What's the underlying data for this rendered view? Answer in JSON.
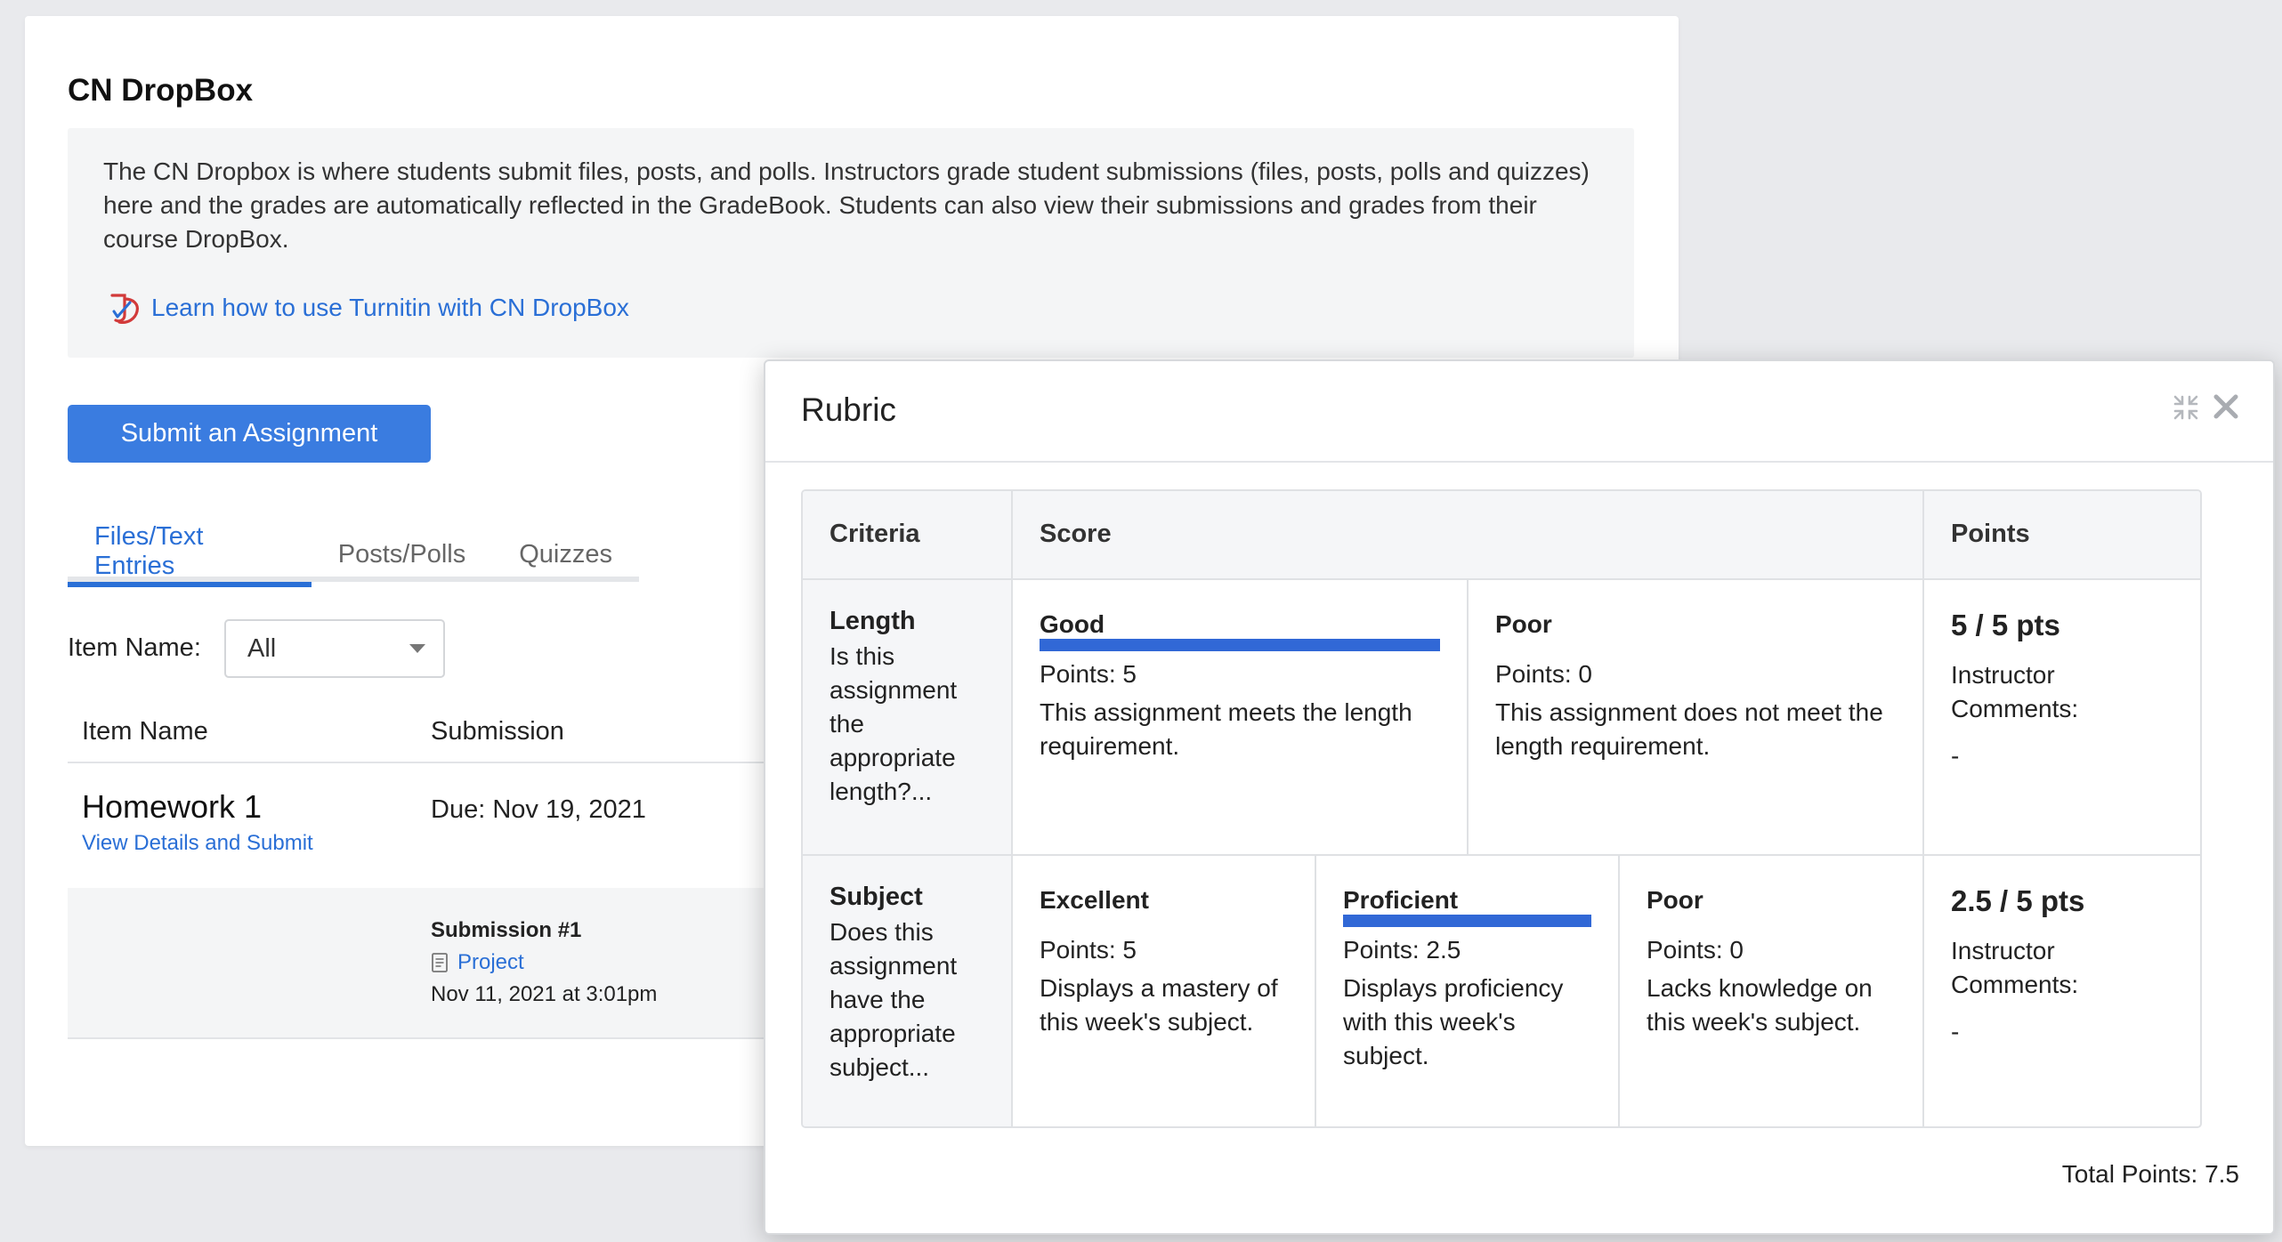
{
  "page": {
    "title": "CN DropBox",
    "info_text": "The CN Dropbox is where students submit files, posts, and polls. Instructors grade student submissions (files, posts, polls and quizzes) here and the grades are automatically reflected in the GradeBook. Students can also view their submissions and grades from their course DropBox.",
    "turnitin_link": "Learn how to use Turnitin with CN DropBox",
    "submit_button": "Submit an Assignment",
    "tabs": [
      {
        "label": "Files/Text Entries",
        "active": true
      },
      {
        "label": "Posts/Polls",
        "active": false
      },
      {
        "label": "Quizzes",
        "active": false
      }
    ],
    "filter": {
      "label": "Item Name:",
      "selected": "All"
    },
    "table": {
      "headers": [
        "Item Name",
        "Submission"
      ],
      "item": {
        "title": "Homework 1",
        "link": "View Details and Submit",
        "due": "Due: Nov 19, 2021",
        "submission": {
          "title": "Submission #1",
          "file": "Project",
          "date": "Nov 11, 2021 at 3:01pm"
        }
      }
    }
  },
  "rubric": {
    "title": "Rubric",
    "headers": {
      "criteria": "Criteria",
      "score": "Score",
      "points": "Points"
    },
    "criteria": [
      {
        "name": "Length",
        "description": "Is this assignment the appropriate length?...",
        "ratings": [
          {
            "label": "Good",
            "points": "Points: 5",
            "description": "This assignment meets the length requirement.",
            "selected": true
          },
          {
            "label": "Poor",
            "points": "Points: 0",
            "description": "This assignment does not meet the length requirement.",
            "selected": false
          }
        ],
        "score": "5 / 5 pts",
        "comments_label": "Instructor Comments:",
        "comments": "-"
      },
      {
        "name": "Subject",
        "description": "Does this assignment have the appropriate subject...",
        "ratings": [
          {
            "label": "Excellent",
            "points": "Points: 5",
            "description": "Displays a mastery of this week's subject.",
            "selected": false
          },
          {
            "label": "Proficient",
            "points": "Points: 2.5",
            "description": "Displays proficiency with this week's subject.",
            "selected": true
          },
          {
            "label": "Poor",
            "points": "Points: 0",
            "description": "Lacks knowledge on this week's subject.",
            "selected": false
          }
        ],
        "score": "2.5 / 5 pts",
        "comments_label": "Instructor Comments:",
        "comments": "-"
      }
    ],
    "total": "Total Points: 7.5"
  },
  "colors": {
    "accent": "#3a7ce0",
    "link": "#2a6fd6",
    "selected_bar": "#3168d6",
    "header_bg": "#f5f6f8"
  },
  "icons": {
    "turnitin": "turnitin-icon",
    "file": "file-icon",
    "collapse": "collapse-icon",
    "close": "close-icon",
    "dropdown": "chevron-down-icon"
  }
}
